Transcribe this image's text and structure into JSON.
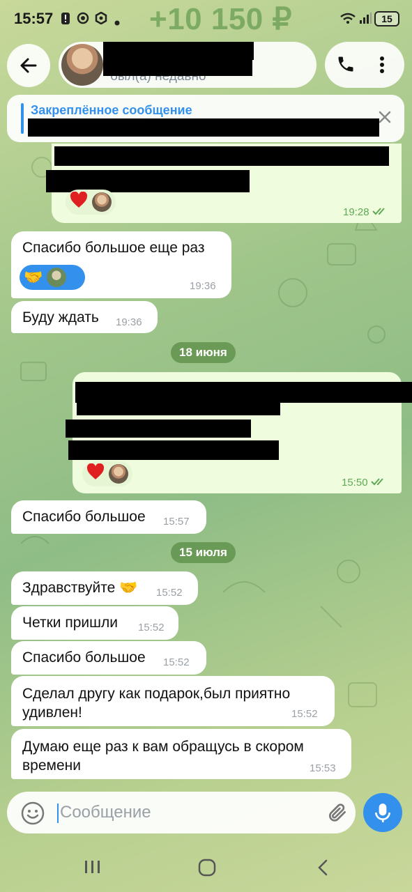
{
  "status_bar": {
    "time": "15:57",
    "balance": "+10 150 ₽",
    "battery": "15"
  },
  "header": {
    "last_seen": "был(а) недавно"
  },
  "pinned": {
    "title": "Закреплённое сообщение"
  },
  "messages": [
    {
      "text": "Спасибо большое еще раз",
      "time": "19:36"
    },
    {
      "text": "Буду ждать",
      "time": "19:36"
    },
    {
      "text": "Спасибо большое",
      "time": "15:57"
    },
    {
      "text": "Здравствуйте 🤝",
      "time": "15:52"
    },
    {
      "text": "Четки пришли",
      "time": "15:52"
    },
    {
      "text": "Спасибо большое",
      "time": "15:52"
    },
    {
      "text": "Сделал другу как подарок,был приятно удивлен!",
      "time": "15:52"
    },
    {
      "text": "Думаю еще раз к вам обращусь в скором времени",
      "time": "15:53"
    }
  ],
  "outgoing": [
    {
      "time": "19:28"
    },
    {
      "time": "15:50"
    }
  ],
  "dates": [
    "18 июня",
    "15 июля"
  ],
  "composer": {
    "placeholder": "Сообщение"
  },
  "colors": {
    "accent": "#3390ec",
    "outgoing_bubble": "#effdde",
    "incoming_bubble": "#ffffff"
  }
}
